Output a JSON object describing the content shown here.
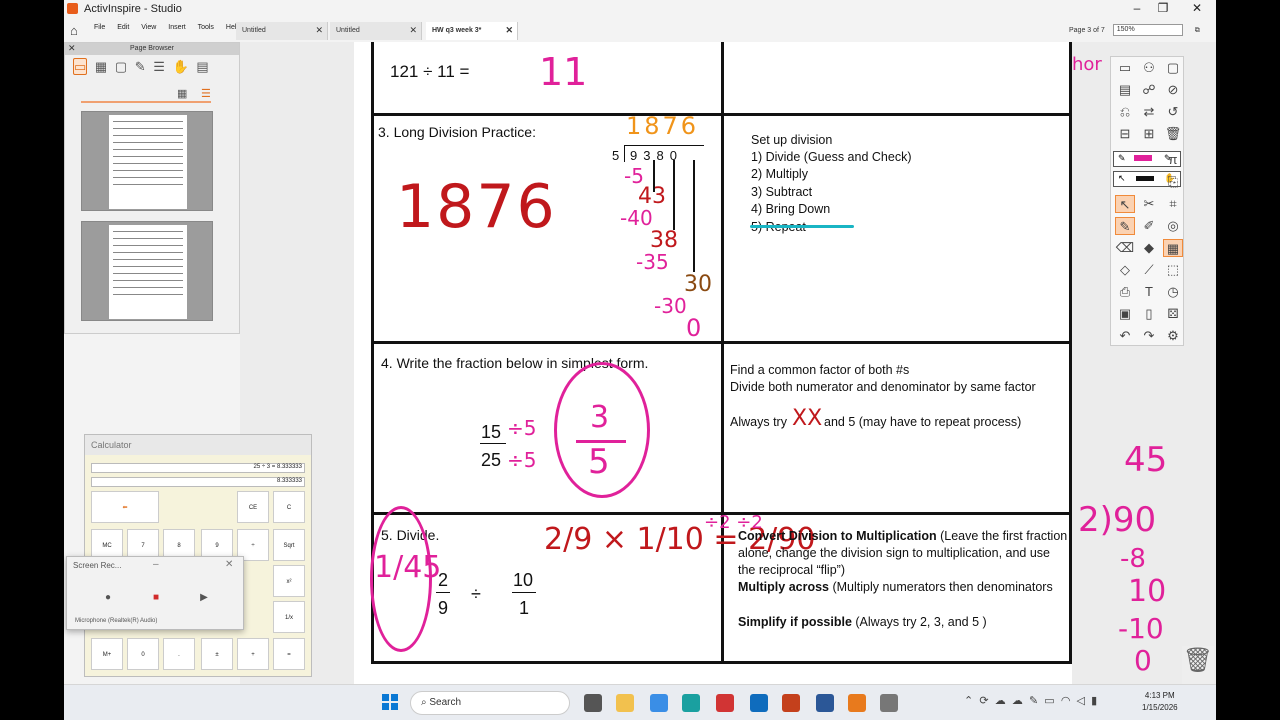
{
  "window": {
    "title": "ActivInspire - Studio"
  },
  "menu": [
    "File",
    "Edit",
    "View",
    "Insert",
    "Tools",
    "Help"
  ],
  "tabs": [
    {
      "label": "Untitled"
    },
    {
      "label": "Untitled"
    },
    {
      "label": "HW q3 week 3*"
    }
  ],
  "page_indicator": "Page 3 of 7",
  "zoom": "150%",
  "page_browser": {
    "title": "Page Browser"
  },
  "worksheet": {
    "row1_problem": "121  ÷  11 =",
    "row1_answer": "11",
    "q3_title": "3.  Long Division Practice:",
    "q3_answer": "1876",
    "q3_quotient": "1876",
    "q3_divisor": "5",
    "q3_dividend": "9380",
    "q3_work": [
      "-5",
      "43",
      "-40",
      "38",
      "-35",
      "30",
      "-30",
      "0"
    ],
    "steps": [
      "Set up division",
      "1)  Divide (Guess and Check)",
      "2)  Multiply",
      "3)  Subtract",
      "4)  Bring Down",
      "5)  Repeat"
    ],
    "q4_title": "4.  Write the fraction below in simplest form.",
    "q4_num": "15",
    "q4_den": "25",
    "q4_ink_div": "÷5",
    "q4_answer_num": "3",
    "q4_answer_den": "5",
    "q4_notes": [
      "Find a common factor of both #s",
      "Divide both numerator and denominator by same factor",
      "Always try",
      "and 5 (may have to repeat process)"
    ],
    "q4_crossed": "XX",
    "q5_title": "5.  Divide.",
    "q5_f1_num": "2",
    "q5_f1_den": "9",
    "q5_div": "÷",
    "q5_f2_num": "10",
    "q5_f2_den": "1",
    "q5_ink_expr": "2/9 × 1/10 = 2/90",
    "q5_ink_simplify": "÷2  ÷2",
    "q5_ink_result": "1/45",
    "q5_ink_side": "45",
    "q5_ink_side2": "2)90",
    "q5_ink_side3": "-8",
    "q5_ink_side4": "10",
    "q5_ink_side5": "-10",
    "q5_ink_side6": "0",
    "q5_notes": [
      {
        "bold": "Convert Division to Multiplication",
        "rest": " (Leave the first fraction alone, change the division sign to multiplication, and use the reciprocal “flip”)"
      },
      {
        "bold": "Multiply across",
        "rest": " (Multiply numerators then denominators"
      },
      {
        "bold": "Simplify if possible",
        "rest": " (Always try 2, 3, and 5 )"
      }
    ],
    "corner_ink": "hor"
  },
  "calculator": {
    "title": "Calculator",
    "display_top": "25 ÷ 3 = 8.333333",
    "display_bottom": "8.333333",
    "keys": [
      "CE",
      "C",
      "MC",
      "7",
      "8",
      "9",
      "÷",
      "Sqrt",
      "x²",
      "1/x",
      "M+",
      "0",
      ".",
      "±",
      "+",
      "="
    ]
  },
  "screen_recorder": {
    "title": "Screen Rec...",
    "mic": "Microphone (Realtek(R) Audio)"
  },
  "taskbar": {
    "search": "Search",
    "time": "4:13 PM",
    "date": "1/15/2026"
  }
}
